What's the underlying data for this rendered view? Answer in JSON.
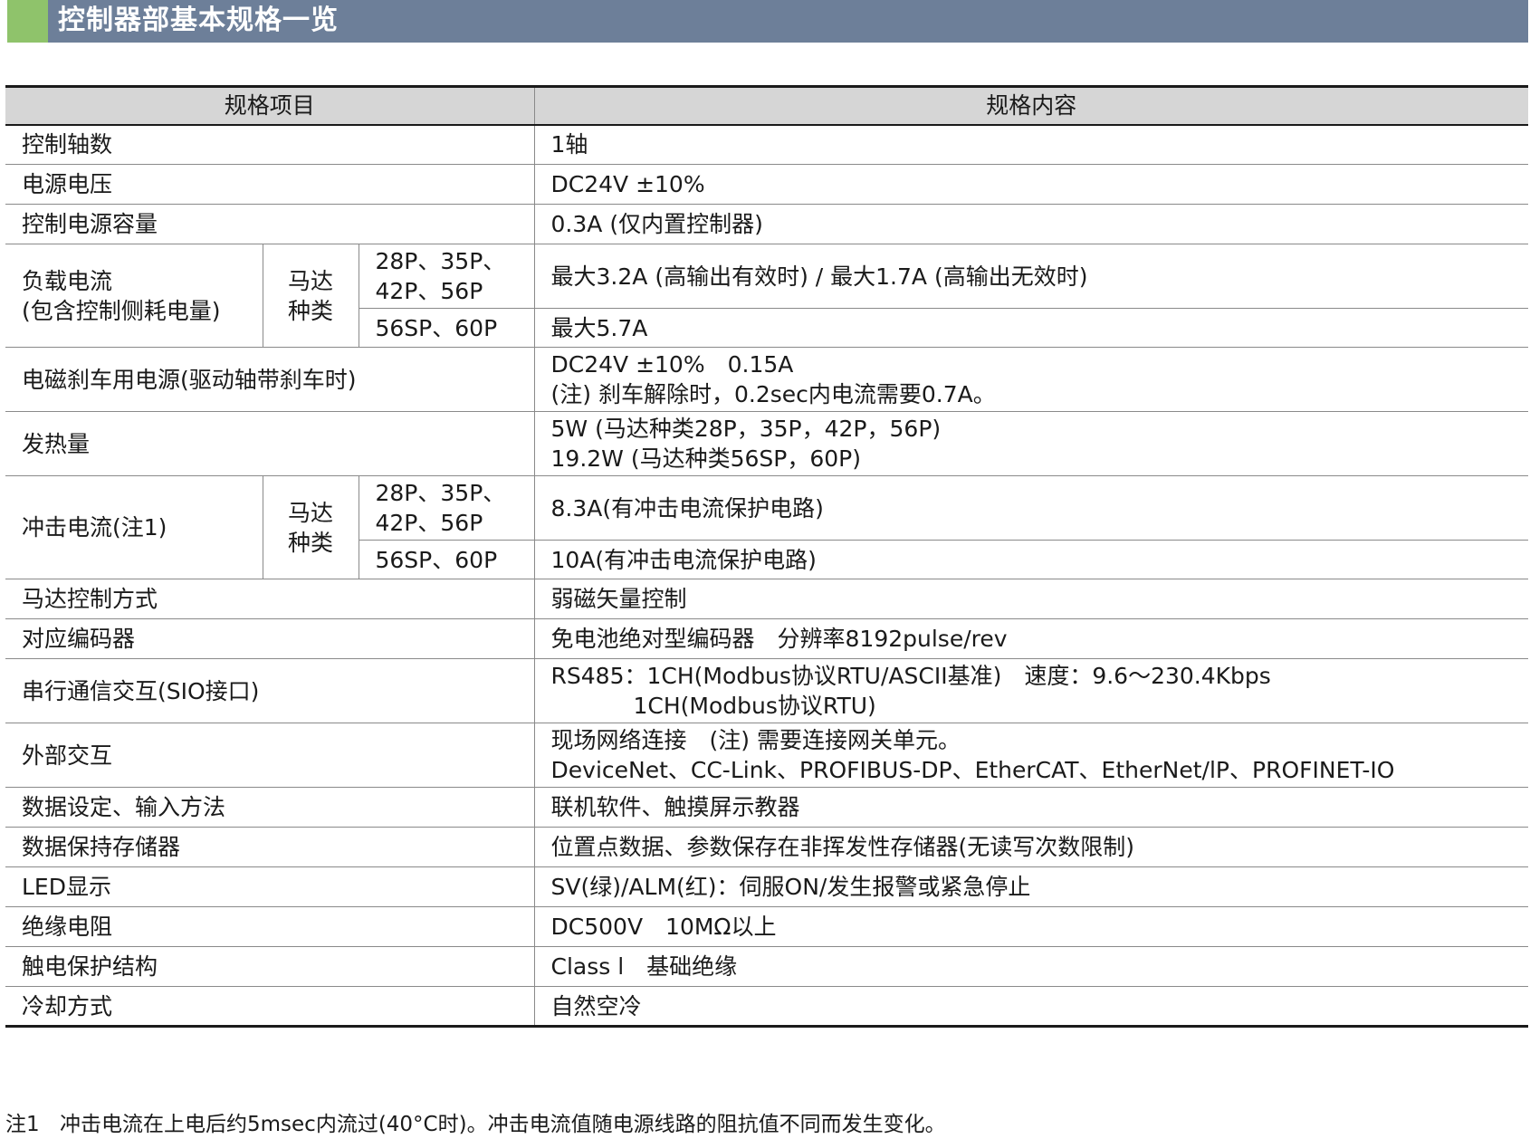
{
  "section_title": "控制器部基本规格一览",
  "table": {
    "headers": {
      "item": "规格项目",
      "content": "规格内容"
    },
    "motor_type_label": [
      "马达",
      "种类"
    ],
    "rows": {
      "axes": {
        "item": "控制轴数",
        "value": "1轴"
      },
      "voltage": {
        "item": "电源电压",
        "value": "DC24V ±10%"
      },
      "capacity": {
        "item": "控制电源容量",
        "value": "0.3A (仅内置控制器)"
      },
      "load_current": {
        "item": [
          "负载电流",
          "(包含控制侧耗电量)"
        ],
        "sub": [
          {
            "motor": [
              "28P、35P、",
              "42P、56P"
            ],
            "value": "最大3.2A (高输出有效时) / 最大1.7A (高输出无效时)"
          },
          {
            "motor": [
              "56SP、60P"
            ],
            "value": "最大5.7A"
          }
        ]
      },
      "brake": {
        "item": "电磁刹车用电源(驱动轴带刹车时)",
        "value": [
          "DC24V ±10%　0.15A",
          "(注) 刹车解除时，0.2sec内电流需要0.7A。"
        ]
      },
      "heat": {
        "item": "发热量",
        "value": [
          "5W (马达种类28P，35P，42P，56P)",
          "19.2W (马达种类56SP，60P)"
        ]
      },
      "inrush": {
        "item": "冲击电流(注1)",
        "sub": [
          {
            "motor": [
              "28P、35P、",
              "42P、56P"
            ],
            "value": "8.3A(有冲击电流保护电路)"
          },
          {
            "motor": [
              "56SP、60P"
            ],
            "value": "10A(有冲击电流保护电路)"
          }
        ]
      },
      "motor_control": {
        "item": "马达控制方式",
        "value": "弱磁矢量控制"
      },
      "encoder": {
        "item": "对应编码器",
        "value": "免电池绝对型编码器　分辨率8192pulse/rev"
      },
      "serial": {
        "item": "串行通信交互(SIO接口)",
        "value": [
          "RS485：1CH(Modbus协议RTU/ASCII基准)　速度：9.6～230.4Kbps",
          "1CH(Modbus协议RTU)"
        ]
      },
      "external": {
        "item": "外部交互",
        "value": [
          "现场网络连接　(注) 需要连接网关单元。",
          "DeviceNet、CC-Link、PROFIBUS-DP、EtherCAT、EtherNet/lP、PROFINET-IO"
        ]
      },
      "data_input": {
        "item": "数据设定、输入方法",
        "value": "联机软件、触摸屏示教器"
      },
      "memory": {
        "item": "数据保持存储器",
        "value": "位置点数据、参数保存在非挥发性存储器(无读写次数限制)"
      },
      "led": {
        "item": "LED显示",
        "value": "SV(绿)/ALM(红)：伺服ON/发生报警或紧急停止"
      },
      "insulation": {
        "item": "绝缘电阻",
        "value": "DC500V　10MΩ以上"
      },
      "shock": {
        "item": "触电保护结构",
        "value": "Class l　基础绝缘"
      },
      "cooling": {
        "item": "冷却方式",
        "value": "自然空冷"
      }
    }
  },
  "footnote": {
    "mark": "注1",
    "text": "冲击电流在上电后约5msec内流过(40°C时)。冲击电流值随电源线路的阻抗值不同而发生变化。"
  },
  "colors": {
    "header_bg": "#6d7f99",
    "header_accent": "#8fc36b",
    "table_header_bg": "#d6d6d6"
  }
}
